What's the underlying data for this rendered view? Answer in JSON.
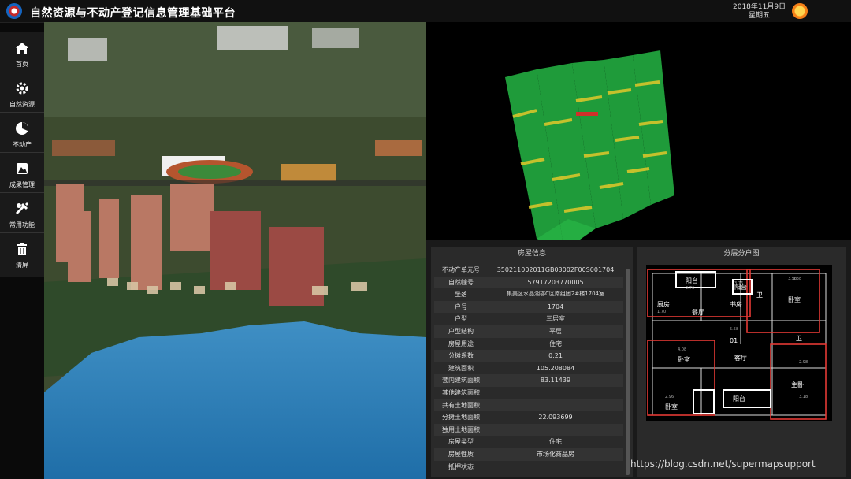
{
  "header": {
    "title": "自然资源与不动产登记信息管理基础平台",
    "date": "2018年11月9日",
    "weekday": "星期五"
  },
  "sidebar": {
    "items": [
      {
        "label": "首页",
        "icon": "home-icon"
      },
      {
        "label": "自然资源",
        "icon": "gear-icon"
      },
      {
        "label": "不动产",
        "icon": "pie-icon"
      },
      {
        "label": "成果管理",
        "icon": "image-icon"
      },
      {
        "label": "常用功能",
        "icon": "tools-icon"
      },
      {
        "label": "清屏",
        "icon": "trash-icon"
      }
    ]
  },
  "house_info": {
    "title": "房屋信息",
    "rows": [
      {
        "k": "不动产单元号",
        "v": "350211002011GB03002F00S001704"
      },
      {
        "k": "自然幢号",
        "v": "57917203770005"
      },
      {
        "k": "坐落",
        "v": "集美区水晶湖郡C区南组团2#楼1704室"
      },
      {
        "k": "户号",
        "v": "1704"
      },
      {
        "k": "户型",
        "v": "三居室"
      },
      {
        "k": "户型结构",
        "v": "平层"
      },
      {
        "k": "房屋用途",
        "v": "住宅"
      },
      {
        "k": "分摊系数",
        "v": "0.21"
      },
      {
        "k": "建筑面积",
        "v": "105.208084"
      },
      {
        "k": "套内建筑面积",
        "v": "83.11439"
      },
      {
        "k": "其他建筑面积",
        "v": ""
      },
      {
        "k": "共有土地面积",
        "v": ""
      },
      {
        "k": "分摊土地面积",
        "v": "22.093699"
      },
      {
        "k": "独用土地面积",
        "v": ""
      },
      {
        "k": "房屋类型",
        "v": "住宅"
      },
      {
        "k": "房屋性质",
        "v": "市场化商品房"
      },
      {
        "k": "抵押状态",
        "v": ""
      }
    ]
  },
  "floor_plan": {
    "title": "分层分户图",
    "rooms": [
      "阳台",
      "阳台",
      "厨房",
      "餐厅",
      "书房",
      "卫",
      "卧室",
      "卫",
      "卧室",
      "客厅",
      "主卧",
      "卧室",
      "阳台",
      "01"
    ],
    "dims": [
      "2.76",
      "3.76",
      "1.70",
      "3.58",
      "4.08",
      "3.38",
      "5.58",
      "2.96",
      "2.98",
      "3.18"
    ]
  },
  "watermark": "https://blog.csdn.net/supermapsupport"
}
